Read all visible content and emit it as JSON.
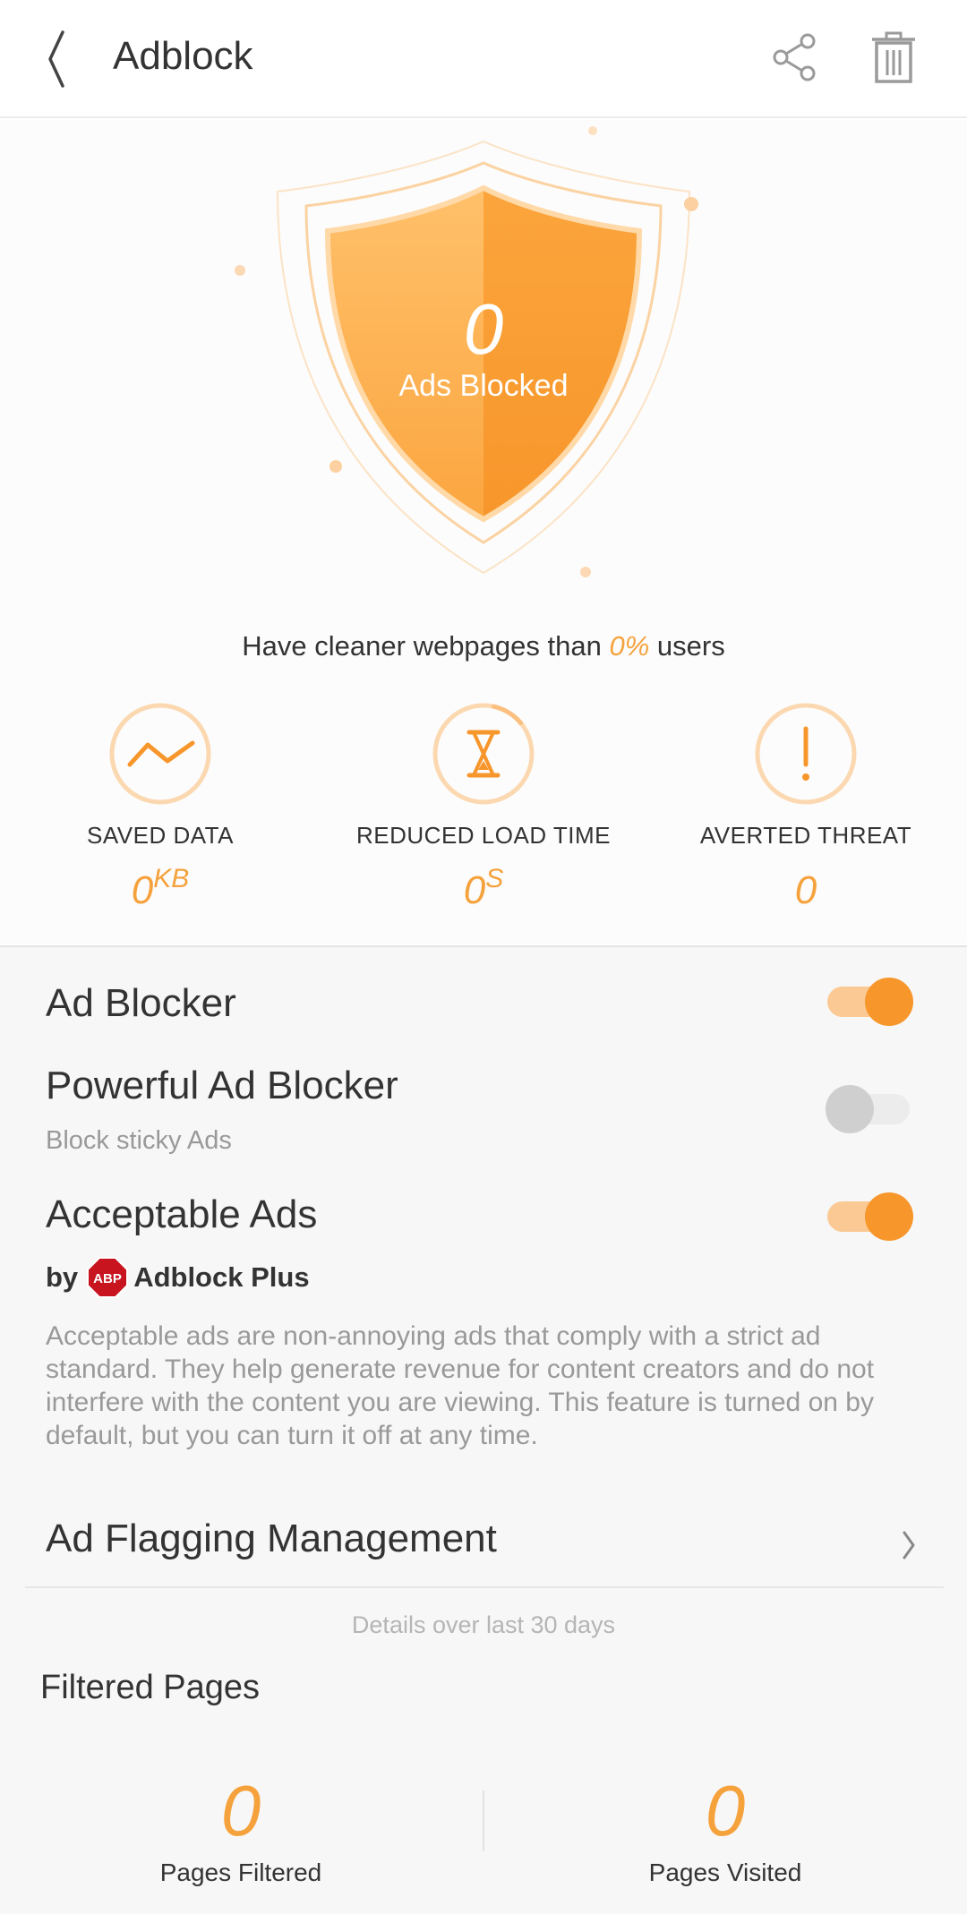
{
  "header": {
    "title": "Adblock"
  },
  "hero": {
    "ads_blocked_count": "0",
    "ads_blocked_label": "Ads Blocked",
    "cleaner_prefix": "Have cleaner webpages than ",
    "cleaner_percent": "0%",
    "cleaner_suffix": " users"
  },
  "stats": [
    {
      "label": "SAVED DATA",
      "value": "0",
      "unit": "KB",
      "icon": "chart-line-icon"
    },
    {
      "label": "REDUCED LOAD TIME",
      "value": "0",
      "unit": "S",
      "icon": "hourglass-icon"
    },
    {
      "label": "AVERTED THREAT",
      "value": "0",
      "unit": "",
      "icon": "exclamation-icon"
    }
  ],
  "settings": {
    "ad_blocker": {
      "label": "Ad Blocker",
      "enabled": true
    },
    "powerful_ad_blocker": {
      "label": "Powerful Ad Blocker",
      "sublabel": "Block sticky Ads",
      "enabled": false
    },
    "acceptable_ads": {
      "label": "Acceptable Ads",
      "enabled": true,
      "by_prefix": "by",
      "logo_text": "ABP",
      "provider": "Adblock Plus",
      "description": "Acceptable ads are non-annoying ads that comply with a strict ad standard. They help generate revenue for content creators and do not interfere with the content you are viewing. This feature is turned on by default, but you can turn it off at any time."
    },
    "ad_flagging": {
      "label": "Ad Flagging Management"
    }
  },
  "details_note": "Details over last 30 days",
  "filtered_pages": {
    "title": "Filtered Pages",
    "pages_filtered": {
      "value": "0",
      "label": "Pages Filtered"
    },
    "pages_visited": {
      "value": "0",
      "label": "Pages Visited"
    }
  },
  "colors": {
    "accent": "#f7962b",
    "accent_light": "#fbc994",
    "text": "#333333",
    "muted": "#999999"
  }
}
